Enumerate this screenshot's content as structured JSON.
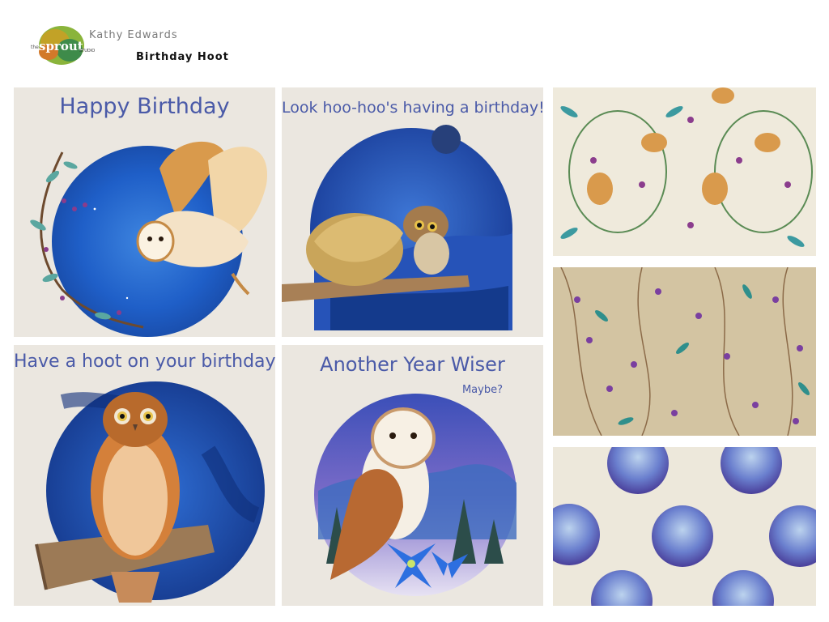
{
  "header": {
    "artist_name": "Kathy Edwards",
    "collection_title": "Birthday Hoot",
    "logo_text": "sprout",
    "logo_subtext": "STUDIO",
    "logo_prefix": "the"
  },
  "cards": [
    {
      "title": "Happy Birthday",
      "subject": "barn owl flying over blue moon with blossom branch"
    },
    {
      "title": "Look hoo-hoo's having a birthday!",
      "subject": "two owls cuddling on a branch"
    },
    {
      "title": "Have a hoot on your birthday",
      "subject": "boobook owl perched on log"
    },
    {
      "title": "Another Year Wiser",
      "subtitle": "Maybe?",
      "subject": "barn owl with blue poinsettia and pine trees"
    }
  ],
  "patterns": [
    {
      "subject": "owl and vine damask pattern"
    },
    {
      "subject": "purple blossom and leaf vine pattern"
    },
    {
      "subject": "blue moon circles polka dot pattern"
    }
  ],
  "colors": {
    "title_blue": "#4a5aa8",
    "card_bg": "#ebe7e0",
    "moon_blue": "#2f5fc4",
    "owl_orange": "#c9853a",
    "pattern1_bg": "#efeadc",
    "pattern2_bg": "#d3c4a2",
    "pattern3_bg": "#ede8db"
  }
}
